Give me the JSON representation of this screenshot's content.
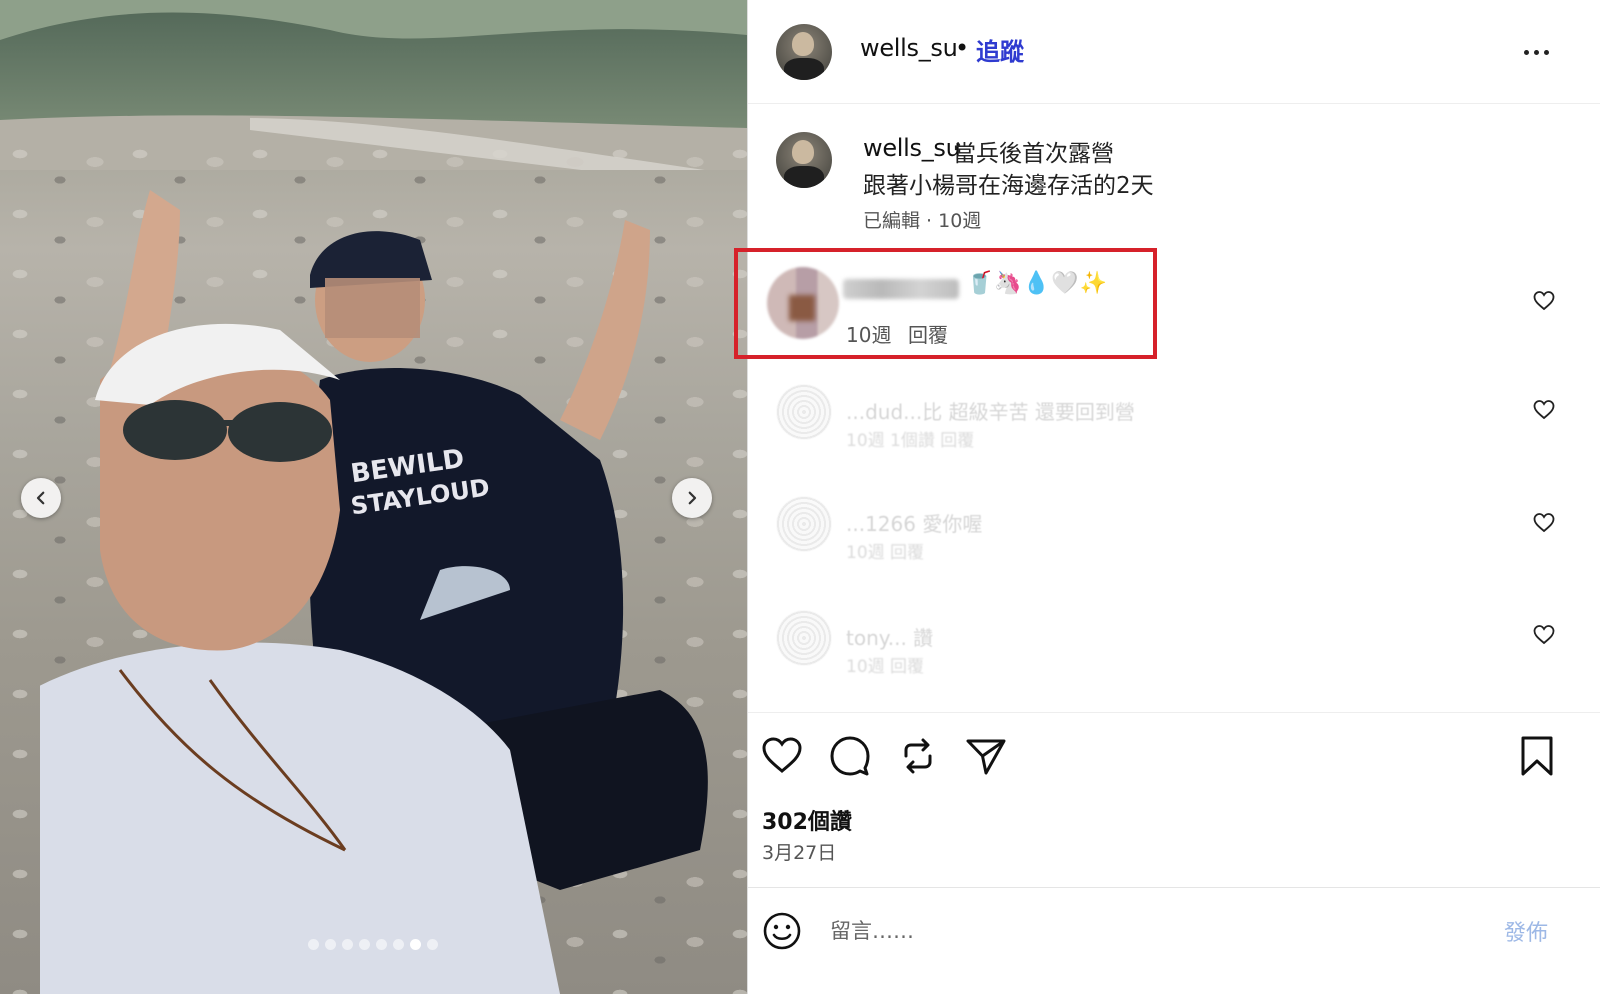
{
  "post": {
    "dots_total": 8,
    "active_dot": 6
  },
  "header": {
    "username": "wells_su",
    "separator": "•",
    "follow_label": "追蹤"
  },
  "caption": {
    "username": "wells_su",
    "line1": "當兵後首次露營",
    "line2": "跟著小楊哥在海邊存活的2天",
    "meta": "已編輯 · 10週"
  },
  "comments": [
    {
      "emoji": "🥤🦄💧🤍✨",
      "time": "10週",
      "reply_label": "回覆",
      "highlight_color": "#d6212a"
    },
    {
      "text": "...dud...比 超級辛苦 還要回到營",
      "sub": "10週   1個讚   回覆"
    },
    {
      "text": "...1266 愛你喔",
      "sub": "10週   回覆"
    },
    {
      "text": "tony... 讚",
      "sub": "10週   回覆"
    }
  ],
  "actions": {
    "likes": "302個讚",
    "date": "3月27日"
  },
  "add_comment": {
    "placeholder": "留言……",
    "post_label": "發佈"
  },
  "colors": {
    "follow": "#2f3bd0",
    "highlight": "#d6212a",
    "post_disabled": "#9db8e6"
  }
}
